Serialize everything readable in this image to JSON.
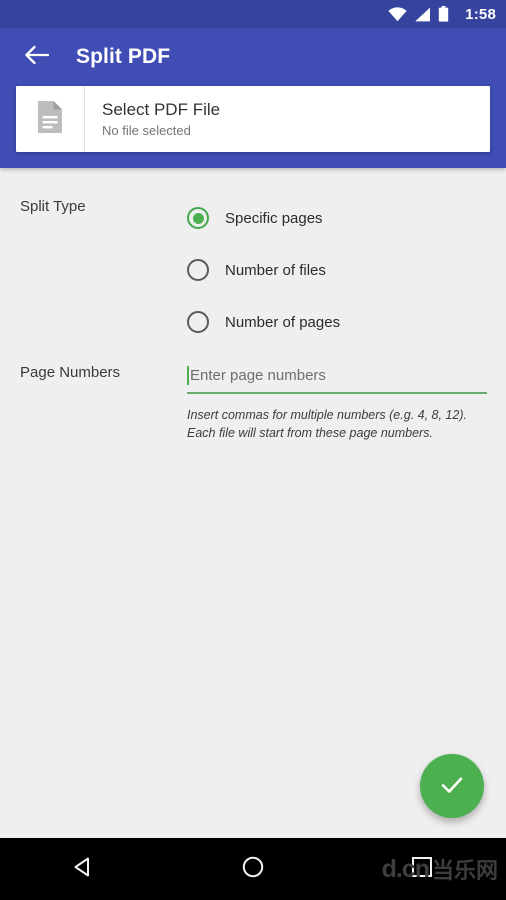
{
  "status_bar": {
    "time": "1:58",
    "icons": [
      "wifi-icon",
      "signal-icon",
      "battery-icon"
    ],
    "background_color": "#37449F"
  },
  "app_bar": {
    "back_icon": "arrow-left-icon",
    "title": "Split PDF",
    "background_color": "#3F4DB5",
    "text_color": "#FFFFFF"
  },
  "file_card": {
    "icon": "document-icon",
    "title": "Select PDF File",
    "subtitle": "No file selected"
  },
  "form": {
    "split_type": {
      "label": "Split Type",
      "options": [
        {
          "label": "Specific pages",
          "selected": true
        },
        {
          "label": "Number of files",
          "selected": false
        },
        {
          "label": "Number of pages",
          "selected": false
        }
      ],
      "accent_color": "#4CB050"
    },
    "page_numbers": {
      "label": "Page Numbers",
      "value": "",
      "placeholder": "Enter page numbers",
      "underline_color": "#69AB6C",
      "hint": "Insert commas for multiple numbers (e.g. 4, 8, 12). Each file will start from these page numbers."
    }
  },
  "fab": {
    "icon": "check-icon",
    "color": "#4CAF50"
  },
  "nav_bar": {
    "back_icon": "triangle-back-icon",
    "home_icon": "circle-home-icon",
    "recents_icon": "square-recents-icon",
    "watermark_latin": "d.cn",
    "watermark_cjk": "当乐网",
    "background_color": "#000000"
  }
}
